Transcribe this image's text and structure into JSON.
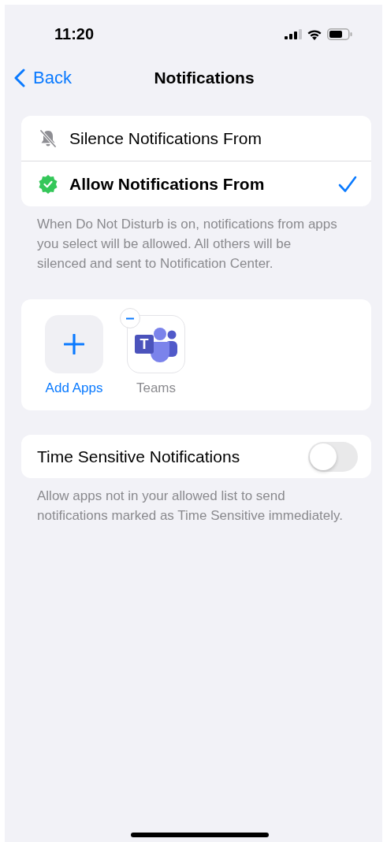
{
  "status_bar": {
    "time": "11:20"
  },
  "nav": {
    "back": "Back",
    "title": "Notifications"
  },
  "modes": [
    {
      "kind": "silence",
      "label": "Silence Notifications From",
      "selected": false
    },
    {
      "kind": "allow",
      "label": "Allow Notifications From",
      "selected": true
    }
  ],
  "modes_footer": "When Do Not Disturb is on, notifications from apps you select will be allowed. All others will be silenced and sent to Notification Center.",
  "apps": [
    {
      "kind": "add",
      "label": "Add Apps"
    },
    {
      "kind": "app",
      "label": "Teams",
      "icon_letter": "T"
    }
  ],
  "time_sensitive": {
    "label": "Time Sensitive Notifications",
    "on": false
  },
  "time_sensitive_footer": "Allow apps not in your allowed list to send notifications marked as Time Sensitive immediately."
}
